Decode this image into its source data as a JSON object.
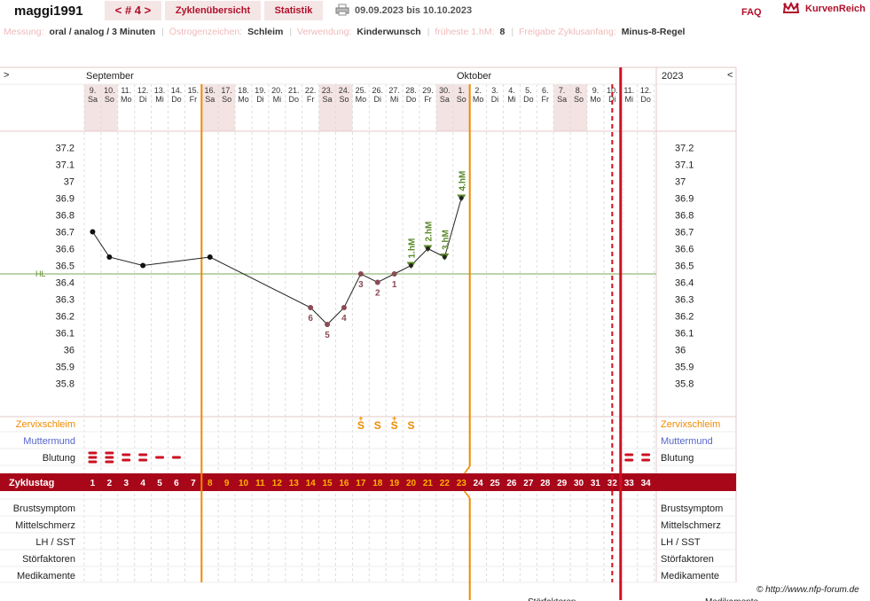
{
  "header": {
    "username": "maggi1991",
    "cycle_nav": "< # 4 >",
    "tab_overview": "Zyklenübersicht",
    "tab_stats": "Statistik",
    "date_range": "09.09.2023 bis 10.10.2023",
    "faq": "FAQ",
    "brand": "KurvenReich",
    "print_icon": "printer-icon",
    "logo_icon": "crown-icon"
  },
  "settings": {
    "messung_label": "Messung:",
    "messung_value": "oral / analog / 3 Minuten",
    "oestrogen_label": "Östrogenzeichen:",
    "oestrogen_value": "Schleim",
    "verwendung_label": "Verwendung:",
    "verwendung_value": "Kinderwunsch",
    "hm_label": "früheste 1.hM:",
    "hm_value": "8",
    "freigabe_label": "Freigabe Zyklusanfang:",
    "freigabe_value": "Minus-8-Regel"
  },
  "colors": {
    "accent": "#a8071a",
    "orange": "#f08a00",
    "green": "#5a8a2a",
    "hl_line": "#7aaa55",
    "weekend": "#f3e3e3",
    "mucus": "#f08a00",
    "muttermund": "#5565cc",
    "bleed": "#cc1122"
  },
  "chart_data": {
    "type": "line",
    "months": {
      "left": "September",
      "mid": "Oktober",
      "year": "2023",
      "nav_left": ">",
      "nav_right": "<"
    },
    "days": [
      {
        "d": "9.",
        "w": "Sa"
      },
      {
        "d": "10.",
        "w": "So"
      },
      {
        "d": "11.",
        "w": "Mo"
      },
      {
        "d": "12.",
        "w": "Di"
      },
      {
        "d": "13.",
        "w": "Mi"
      },
      {
        "d": "14.",
        "w": "Do"
      },
      {
        "d": "15.",
        "w": "Fr"
      },
      {
        "d": "16.",
        "w": "Sa"
      },
      {
        "d": "17.",
        "w": "So"
      },
      {
        "d": "18.",
        "w": "Mo"
      },
      {
        "d": "19.",
        "w": "Di"
      },
      {
        "d": "20.",
        "w": "Mi"
      },
      {
        "d": "21.",
        "w": "Do"
      },
      {
        "d": "22.",
        "w": "Fr"
      },
      {
        "d": "23.",
        "w": "Sa"
      },
      {
        "d": "24.",
        "w": "So"
      },
      {
        "d": "25.",
        "w": "Mo"
      },
      {
        "d": "26.",
        "w": "Di"
      },
      {
        "d": "27.",
        "w": "Mi"
      },
      {
        "d": "28.",
        "w": "Do"
      },
      {
        "d": "29.",
        "w": "Fr"
      },
      {
        "d": "30.",
        "w": "Sa"
      },
      {
        "d": "1.",
        "w": "So"
      },
      {
        "d": "2.",
        "w": "Mo"
      },
      {
        "d": "3.",
        "w": "Di"
      },
      {
        "d": "4.",
        "w": "Mi"
      },
      {
        "d": "5.",
        "w": "Do"
      },
      {
        "d": "6.",
        "w": "Fr"
      },
      {
        "d": "7.",
        "w": "Sa"
      },
      {
        "d": "8.",
        "w": "So"
      },
      {
        "d": "9.",
        "w": "Mo"
      },
      {
        "d": "10.",
        "w": "Di"
      },
      {
        "d": "11.",
        "w": "Mi"
      },
      {
        "d": "12.",
        "w": "Do"
      }
    ],
    "y_ticks": [
      "37.2",
      "37.1",
      "37",
      "36.9",
      "36.8",
      "36.7",
      "36.6",
      "36.5",
      "36.4",
      "36.3",
      "36.2",
      "36.1",
      "36",
      "35.9",
      "35.8"
    ],
    "ylim": [
      35.75,
      37.25
    ],
    "hl_value": 36.45,
    "hl_label": "HL",
    "temperatures": [
      {
        "day": 1,
        "t": 36.7,
        "kind": "normal"
      },
      {
        "day": 2,
        "t": 36.55,
        "kind": "normal"
      },
      {
        "day": 4,
        "t": 36.5,
        "kind": "normal"
      },
      {
        "day": 8,
        "t": 36.55,
        "kind": "normal"
      },
      {
        "day": 14,
        "t": 36.25,
        "kind": "low",
        "label": "6"
      },
      {
        "day": 15,
        "t": 36.15,
        "kind": "low",
        "label": "5"
      },
      {
        "day": 16,
        "t": 36.25,
        "kind": "low",
        "label": "4"
      },
      {
        "day": 17,
        "t": 36.45,
        "kind": "low",
        "label": "3"
      },
      {
        "day": 18,
        "t": 36.4,
        "kind": "low",
        "label": "2"
      },
      {
        "day": 19,
        "t": 36.45,
        "kind": "low",
        "label": "1"
      },
      {
        "day": 20,
        "t": 36.5,
        "kind": "high",
        "label": "1.hM"
      },
      {
        "day": 21,
        "t": 36.6,
        "kind": "high",
        "label": "2.hM"
      },
      {
        "day": 22,
        "t": 36.55,
        "kind": "high",
        "label": "3.hM"
      },
      {
        "day": 23,
        "t": 36.9,
        "kind": "high",
        "label": "4.hM"
      }
    ],
    "mucus": [
      {
        "day": 17,
        "sym": "S",
        "plus": true
      },
      {
        "day": 18,
        "sym": "S",
        "plus": false
      },
      {
        "day": 19,
        "sym": "S",
        "plus": true
      },
      {
        "day": 20,
        "sym": "S",
        "plus": false
      }
    ],
    "bleeding": [
      {
        "day": 1,
        "level": 3
      },
      {
        "day": 2,
        "level": 3
      },
      {
        "day": 3,
        "level": 2
      },
      {
        "day": 4,
        "level": 2
      },
      {
        "day": 5,
        "level": 1
      },
      {
        "day": 6,
        "level": 1
      },
      {
        "day": 33,
        "level": 2
      },
      {
        "day": 34,
        "level": 2
      }
    ],
    "cycle_row_label": "Zyklustag",
    "cycle_days": [
      "1",
      "2",
      "3",
      "4",
      "5",
      "6",
      "7",
      "8",
      "9",
      "10",
      "11",
      "12",
      "13",
      "14",
      "15",
      "16",
      "17",
      "18",
      "19",
      "20",
      "21",
      "22",
      "23",
      "24",
      "25",
      "26",
      "27",
      "28",
      "29",
      "30",
      "31",
      "32",
      "33",
      "34"
    ],
    "highlight_days": [
      8,
      9,
      10,
      11,
      12,
      13,
      14,
      15,
      16,
      17,
      18,
      19,
      20,
      21,
      22,
      23
    ],
    "row_labels": {
      "zervix": "Zervixschleim",
      "muttermund": "Muttermund",
      "blutung": "Blutung",
      "brust": "Brustsymptom",
      "mittel": "Mittelschmerz",
      "lh": "LH / SST",
      "stoer": "Störfaktoren",
      "medi": "Medikamente"
    },
    "grid": true
  },
  "footer": {
    "copyright": "© http://www.nfp-forum.de",
    "cut_left": "Störfaktoren",
    "cut_right": "Medikamente"
  }
}
